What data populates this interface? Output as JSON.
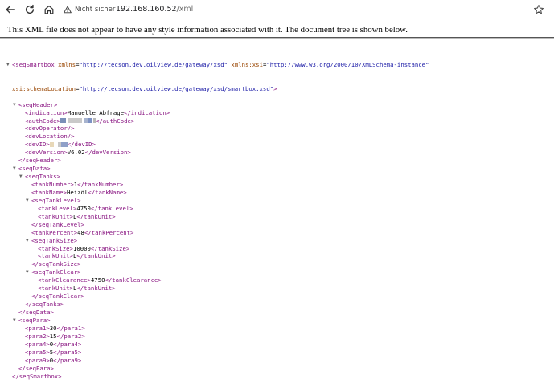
{
  "browser": {
    "security_label": "Nicht sicher",
    "url_host": "192.168.160.52",
    "url_path": "/xml"
  },
  "banner": {
    "text": "This XML file does not appear to have any style information associated with it. The document tree is shown below."
  },
  "xml": {
    "root_open": "<seqSmartbox",
    "attr_xmlns_name": "xmlns",
    "attr_xmlns_value": "\"http://tecson.dev.oilview.de/gateway/xsd\"",
    "attr_xsi_name": "xmlns:xsi",
    "attr_xsi_value": "\"http://www.w3.org/2000/10/XMLSchema-instance\"",
    "attr_schema_name": "xsi:schemaLocation",
    "attr_schema_value": "\"http://tecson.dev.oilview.de/gateway/xsd/smartbox.xsd\"",
    "lines": [
      {
        "indent": 1,
        "toggle": true,
        "parts": [
          [
            "tg",
            "<seqHeader>"
          ]
        ]
      },
      {
        "indent": 2,
        "toggle": false,
        "parts": [
          [
            "tg",
            "<indication>"
          ],
          [
            "tx",
            "Manuelle Abfrage"
          ],
          [
            "tg",
            "</indication>"
          ]
        ]
      },
      {
        "indent": 2,
        "toggle": false,
        "parts": [
          [
            "tg",
            "<authCode>"
          ],
          [
            "redact",
            "auth"
          ],
          [
            "tg",
            "</authCode>"
          ]
        ]
      },
      {
        "indent": 2,
        "toggle": false,
        "parts": [
          [
            "tg",
            "<devOperator/>"
          ]
        ]
      },
      {
        "indent": 2,
        "toggle": false,
        "parts": [
          [
            "tg",
            "<devLocation/>"
          ]
        ]
      },
      {
        "indent": 2,
        "toggle": false,
        "parts": [
          [
            "tg",
            "<devID>"
          ],
          [
            "redact",
            "dev"
          ],
          [
            "tg",
            "</devID>"
          ]
        ]
      },
      {
        "indent": 2,
        "toggle": false,
        "parts": [
          [
            "tg",
            "<devVersion>"
          ],
          [
            "tx",
            "V6.02"
          ],
          [
            "tg",
            "</devVersion>"
          ]
        ]
      },
      {
        "indent": 1,
        "toggle": false,
        "parts": [
          [
            "tg",
            "</seqHeader>"
          ]
        ]
      },
      {
        "indent": 1,
        "toggle": true,
        "parts": [
          [
            "tg",
            "<seqData>"
          ]
        ]
      },
      {
        "indent": 2,
        "toggle": true,
        "parts": [
          [
            "tg",
            "<seqTanks>"
          ]
        ]
      },
      {
        "indent": 3,
        "toggle": false,
        "parts": [
          [
            "tg",
            "<tankNumber>"
          ],
          [
            "tx",
            "1"
          ],
          [
            "tg",
            "</tankNumber>"
          ]
        ]
      },
      {
        "indent": 3,
        "toggle": false,
        "parts": [
          [
            "tg",
            "<tankName>"
          ],
          [
            "tx",
            "Heizöl"
          ],
          [
            "tg",
            "</tankName>"
          ]
        ]
      },
      {
        "indent": 3,
        "toggle": true,
        "parts": [
          [
            "tg",
            "<seqTankLevel>"
          ]
        ]
      },
      {
        "indent": 4,
        "toggle": false,
        "parts": [
          [
            "tg",
            "<tankLevel>"
          ],
          [
            "tx",
            "4750"
          ],
          [
            "tg",
            "</tankLevel>"
          ]
        ]
      },
      {
        "indent": 4,
        "toggle": false,
        "parts": [
          [
            "tg",
            "<tankUnit>"
          ],
          [
            "tx",
            "L"
          ],
          [
            "tg",
            "</tankUnit>"
          ]
        ]
      },
      {
        "indent": 3,
        "toggle": false,
        "parts": [
          [
            "tg",
            "</seqTankLevel>"
          ]
        ]
      },
      {
        "indent": 3,
        "toggle": false,
        "parts": [
          [
            "tg",
            "<tankPercent>"
          ],
          [
            "tx",
            "48"
          ],
          [
            "tg",
            "</tankPercent>"
          ]
        ]
      },
      {
        "indent": 3,
        "toggle": true,
        "parts": [
          [
            "tg",
            "<seqTankSize>"
          ]
        ]
      },
      {
        "indent": 4,
        "toggle": false,
        "parts": [
          [
            "tg",
            "<tankSize>"
          ],
          [
            "tx",
            "10000"
          ],
          [
            "tg",
            "</tankSize>"
          ]
        ]
      },
      {
        "indent": 4,
        "toggle": false,
        "parts": [
          [
            "tg",
            "<tankUnit>"
          ],
          [
            "tx",
            "L"
          ],
          [
            "tg",
            "</tankUnit>"
          ]
        ]
      },
      {
        "indent": 3,
        "toggle": false,
        "parts": [
          [
            "tg",
            "</seqTankSize>"
          ]
        ]
      },
      {
        "indent": 3,
        "toggle": true,
        "parts": [
          [
            "tg",
            "<seqTankClear>"
          ]
        ]
      },
      {
        "indent": 4,
        "toggle": false,
        "parts": [
          [
            "tg",
            "<tankClearance>"
          ],
          [
            "tx",
            "4750"
          ],
          [
            "tg",
            "</tankClearance>"
          ]
        ]
      },
      {
        "indent": 4,
        "toggle": false,
        "parts": [
          [
            "tg",
            "<tankUnit>"
          ],
          [
            "tx",
            "L"
          ],
          [
            "tg",
            "</tankUnit>"
          ]
        ]
      },
      {
        "indent": 3,
        "toggle": false,
        "parts": [
          [
            "tg",
            "</seqTankClear>"
          ]
        ]
      },
      {
        "indent": 2,
        "toggle": false,
        "parts": [
          [
            "tg",
            "</seqTanks>"
          ]
        ]
      },
      {
        "indent": 1,
        "toggle": false,
        "parts": [
          [
            "tg",
            "</seqData>"
          ]
        ]
      },
      {
        "indent": 1,
        "toggle": true,
        "parts": [
          [
            "tg",
            "<seqPara>"
          ]
        ]
      },
      {
        "indent": 2,
        "toggle": false,
        "parts": [
          [
            "tg",
            "<para1>"
          ],
          [
            "tx",
            "30"
          ],
          [
            "tg",
            "</para1>"
          ]
        ]
      },
      {
        "indent": 2,
        "toggle": false,
        "parts": [
          [
            "tg",
            "<para2>"
          ],
          [
            "tx",
            "15"
          ],
          [
            "tg",
            "</para2>"
          ]
        ]
      },
      {
        "indent": 2,
        "toggle": false,
        "parts": [
          [
            "tg",
            "<para4>"
          ],
          [
            "tx",
            "0"
          ],
          [
            "tg",
            "</para4>"
          ]
        ]
      },
      {
        "indent": 2,
        "toggle": false,
        "parts": [
          [
            "tg",
            "<para5>"
          ],
          [
            "tx",
            "5"
          ],
          [
            "tg",
            "</para5>"
          ]
        ]
      },
      {
        "indent": 2,
        "toggle": false,
        "parts": [
          [
            "tg",
            "<para9>"
          ],
          [
            "tx",
            "0"
          ],
          [
            "tg",
            "</para9>"
          ]
        ]
      },
      {
        "indent": 1,
        "toggle": false,
        "parts": [
          [
            "tg",
            "</seqPara>"
          ]
        ]
      },
      {
        "indent": 0,
        "toggle": false,
        "parts": [
          [
            "tg",
            "</seqSmartbox>"
          ]
        ]
      }
    ]
  },
  "colors": {
    "tag": "#881280",
    "attr_name": "#994500",
    "attr_value": "#1a1aa6"
  }
}
